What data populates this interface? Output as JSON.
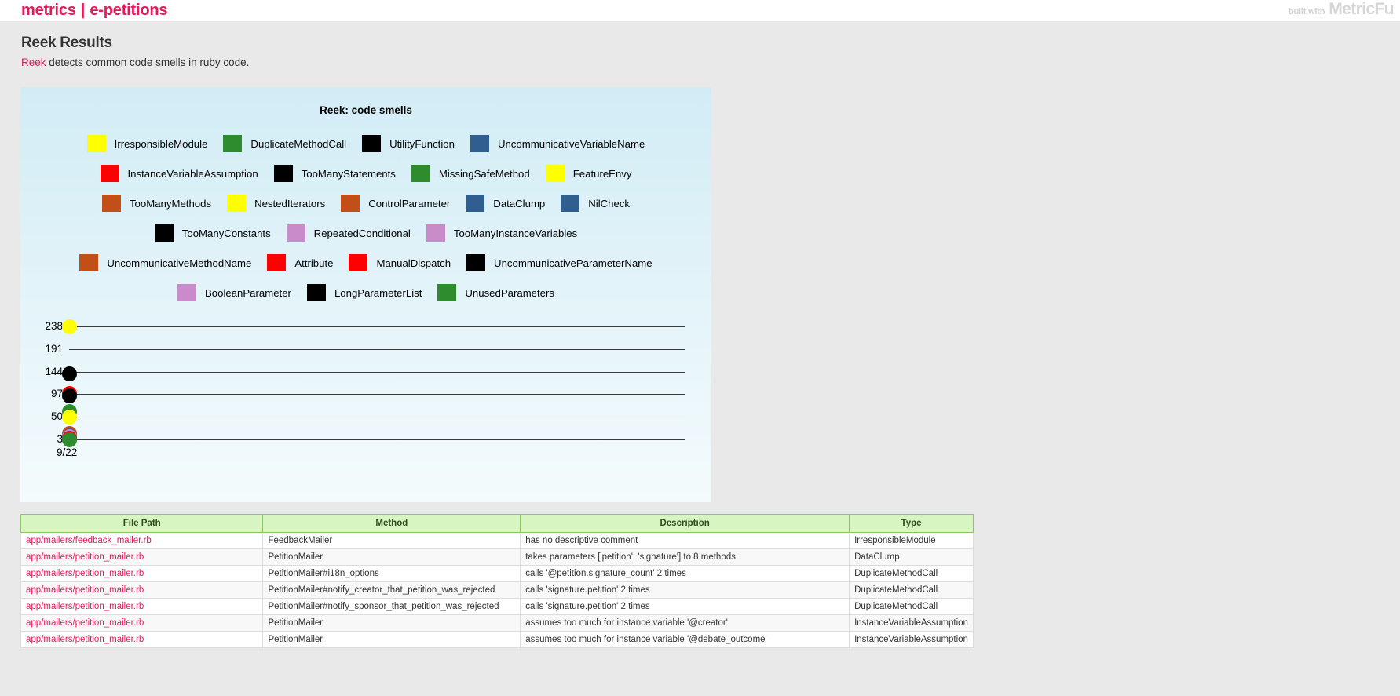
{
  "topbar": {
    "nav": [
      {
        "label": "metrics"
      },
      {
        "label": "e-petitions"
      }
    ],
    "separator": "|",
    "built_with_prefix": "built with",
    "built_with_brand": "MetricFu"
  },
  "page": {
    "title": "Reek Results",
    "desc_link": "Reek",
    "desc_rest": " detects common code smells in ruby code."
  },
  "colors": {
    "accent_pink": "#E8185B",
    "yellow": "#FFFF00",
    "green": "#2E8B2E",
    "black": "#000000",
    "blue": "#2F5E8F",
    "red": "#FF0000",
    "orange": "#C25016",
    "purple": "#C98BC9",
    "panel_bg": "#d2ecf5",
    "header_green": "#d6f5c0"
  },
  "chart_data": {
    "type": "scatter",
    "title": "Reek: code smells",
    "xlabel": "",
    "ylabel": "",
    "grid": true,
    "legend_position": "top",
    "x": [
      "9/22"
    ],
    "yticks": [
      3,
      50,
      97,
      144,
      191,
      238
    ],
    "ylim": [
      3,
      238
    ],
    "legend": [
      {
        "label": "IrresponsibleModule",
        "color": "#FFFF00"
      },
      {
        "label": "DuplicateMethodCall",
        "color": "#2E8B2E"
      },
      {
        "label": "UtilityFunction",
        "color": "#000000"
      },
      {
        "label": "UncommunicativeVariableName",
        "color": "#2F5E8F"
      },
      {
        "label": "InstanceVariableAssumption",
        "color": "#FF0000"
      },
      {
        "label": "TooManyStatements",
        "color": "#000000"
      },
      {
        "label": "MissingSafeMethod",
        "color": "#2E8B2E"
      },
      {
        "label": "FeatureEnvy",
        "color": "#FFFF00"
      },
      {
        "label": "TooManyMethods",
        "color": "#C25016"
      },
      {
        "label": "NestedIterators",
        "color": "#FFFF00"
      },
      {
        "label": "ControlParameter",
        "color": "#C25016"
      },
      {
        "label": "DataClump",
        "color": "#2F5E8F"
      },
      {
        "label": "NilCheck",
        "color": "#2F5E8F"
      },
      {
        "label": "TooManyConstants",
        "color": "#000000"
      },
      {
        "label": "RepeatedConditional",
        "color": "#C98BC9"
      },
      {
        "label": "TooManyInstanceVariables",
        "color": "#C98BC9"
      },
      {
        "label": "UncommunicativeMethodName",
        "color": "#C25016"
      },
      {
        "label": "Attribute",
        "color": "#FF0000"
      },
      {
        "label": "ManualDispatch",
        "color": "#FF0000"
      },
      {
        "label": "UncommunicativeParameterName",
        "color": "#000000"
      },
      {
        "label": "BooleanParameter",
        "color": "#C98BC9"
      },
      {
        "label": "LongParameterList",
        "color": "#000000"
      },
      {
        "label": "UnusedParameters",
        "color": "#2E8B2E"
      }
    ],
    "legend_rows": [
      [
        0,
        1,
        2,
        3
      ],
      [
        4,
        5,
        6,
        7
      ],
      [
        8,
        9,
        10,
        11,
        12
      ],
      [
        13,
        14,
        15
      ],
      [
        16,
        17,
        18,
        19
      ],
      [
        20,
        21,
        22
      ]
    ],
    "series": [
      {
        "name": "IrresponsibleModule",
        "color": "#FFFF00",
        "values": [
          238
        ]
      },
      {
        "name": "UtilityFunction",
        "color": "#000000",
        "values": [
          140
        ]
      },
      {
        "name": "InstanceVariableAssumption",
        "color": "#FF0000",
        "values": [
          99
        ]
      },
      {
        "name": "TooManyStatements",
        "color": "#000000",
        "values": [
          95
        ]
      },
      {
        "name": "MissingSafeMethod",
        "color": "#2E8B2E",
        "values": [
          62
        ]
      },
      {
        "name": "FeatureEnvy",
        "color": "#FFFF00",
        "values": [
          50
        ]
      },
      {
        "name": "TooManyMethods",
        "color": "#C25016",
        "values": [
          16
        ]
      },
      {
        "name": "NilCheck",
        "color": "#2F5E8F",
        "values": [
          11
        ]
      },
      {
        "name": "RepeatedConditional",
        "color": "#C98BC9",
        "values": [
          9
        ]
      },
      {
        "name": "ManualDispatch",
        "color": "#FF0000",
        "values": [
          7
        ]
      },
      {
        "name": "UnusedParameters",
        "color": "#2E8B2E",
        "values": [
          3
        ]
      }
    ]
  },
  "table": {
    "columns": [
      "File Path",
      "Method",
      "Description",
      "Type"
    ],
    "rows": [
      {
        "file_path": "app/mailers/feedback_mailer.rb",
        "method": "FeedbackMailer",
        "description": "has no descriptive comment",
        "type": "IrresponsibleModule"
      },
      {
        "file_path": "app/mailers/petition_mailer.rb",
        "method": "PetitionMailer",
        "description": "takes parameters ['petition', 'signature'] to 8 methods",
        "type": "DataClump"
      },
      {
        "file_path": "app/mailers/petition_mailer.rb",
        "method": "PetitionMailer#i18n_options",
        "description": "calls '@petition.signature_count' 2 times",
        "type": "DuplicateMethodCall"
      },
      {
        "file_path": "app/mailers/petition_mailer.rb",
        "method": "PetitionMailer#notify_creator_that_petition_was_rejected",
        "description": "calls 'signature.petition' 2 times",
        "type": "DuplicateMethodCall"
      },
      {
        "file_path": "app/mailers/petition_mailer.rb",
        "method": "PetitionMailer#notify_sponsor_that_petition_was_rejected",
        "description": "calls 'signature.petition' 2 times",
        "type": "DuplicateMethodCall"
      },
      {
        "file_path": "app/mailers/petition_mailer.rb",
        "method": "PetitionMailer",
        "description": "assumes too much for instance variable '@creator'",
        "type": "InstanceVariableAssumption"
      },
      {
        "file_path": "app/mailers/petition_mailer.rb",
        "method": "PetitionMailer",
        "description": "assumes too much for instance variable '@debate_outcome'",
        "type": "InstanceVariableAssumption"
      }
    ]
  }
}
